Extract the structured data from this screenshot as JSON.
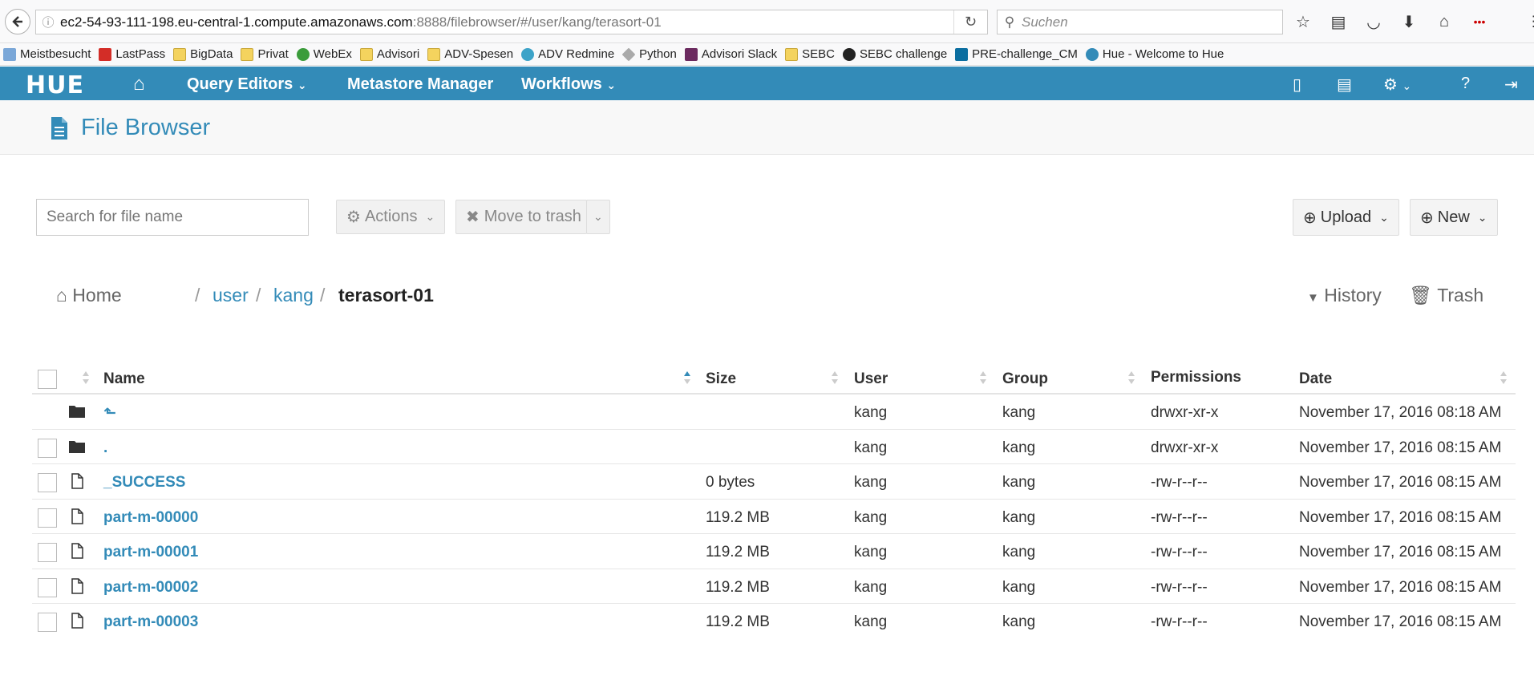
{
  "browser": {
    "url_host": "ec2-54-93-111-198.eu-central-1.compute.amazonaws.com",
    "url_path": ":8888/filebrowser/#/user/kang/terasort-01",
    "search_placeholder": "Suchen",
    "bookmarks": [
      "Meistbesucht",
      "LastPass",
      "BigData",
      "Privat",
      "WebEx",
      "Advisori",
      "ADV-Spesen",
      "ADV Redmine",
      "Python",
      "Advisori Slack",
      "SEBC",
      "SEBC challenge",
      "PRE-challenge_CM",
      "Hue - Welcome to Hue"
    ]
  },
  "hue_nav": {
    "logo": "HUE",
    "query_editors": "Query Editors",
    "metastore": "Metastore Manager",
    "workflows": "Workflows"
  },
  "page": {
    "title": "File Browser"
  },
  "toolbar": {
    "search_placeholder": "Search for file name",
    "actions": "Actions",
    "move_to_trash": "Move to trash",
    "upload": "Upload",
    "new": "New"
  },
  "breadcrumb": {
    "home": "Home",
    "user": "user",
    "kang": "kang",
    "current": "terasort-01",
    "history": "History",
    "trash": "Trash"
  },
  "table": {
    "headers": {
      "name": "Name",
      "size": "Size",
      "user": "User",
      "group": "Group",
      "permissions": "Permissions",
      "date": "Date"
    },
    "rows": [
      {
        "name": "⬑",
        "size": "",
        "user": "kang",
        "group": "kang",
        "permissions": "drwxr-xr-x",
        "date": "November 17, 2016 08:18 AM"
      },
      {
        "name": ".",
        "size": "",
        "user": "kang",
        "group": "kang",
        "permissions": "drwxr-xr-x",
        "date": "November 17, 2016 08:15 AM"
      },
      {
        "name": "_SUCCESS",
        "size": "0 bytes",
        "user": "kang",
        "group": "kang",
        "permissions": "-rw-r--r--",
        "date": "November 17, 2016 08:15 AM"
      },
      {
        "name": "part-m-00000",
        "size": "119.2 MB",
        "user": "kang",
        "group": "kang",
        "permissions": "-rw-r--r--",
        "date": "November 17, 2016 08:15 AM"
      },
      {
        "name": "part-m-00001",
        "size": "119.2 MB",
        "user": "kang",
        "group": "kang",
        "permissions": "-rw-r--r--",
        "date": "November 17, 2016 08:15 AM"
      },
      {
        "name": "part-m-00002",
        "size": "119.2 MB",
        "user": "kang",
        "group": "kang",
        "permissions": "-rw-r--r--",
        "date": "November 17, 2016 08:15 AM"
      },
      {
        "name": "part-m-00003",
        "size": "119.2 MB",
        "user": "kang",
        "group": "kang",
        "permissions": "-rw-r--r--",
        "date": "November 17, 2016 08:15 AM"
      }
    ]
  }
}
